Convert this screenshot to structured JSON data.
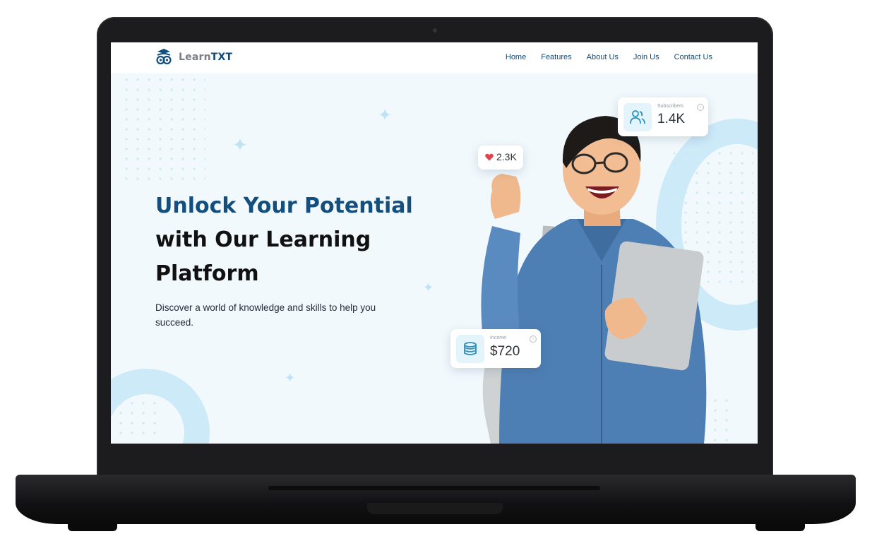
{
  "brand": {
    "name_part1": "Learn",
    "name_part2": "TXT"
  },
  "nav": [
    "Home",
    "Features",
    "About Us",
    "Join Us",
    "Contact Us"
  ],
  "hero": {
    "headline_highlight": "Unlock Your Potential",
    "headline_rest": "with Our Learning Platform",
    "subtitle": "Discover a world of knowledge and skills to help you succeed."
  },
  "stats": {
    "likes": "2.3K",
    "subscribers_label": "Subscribers",
    "subscribers_value": "1.4K",
    "income_label": "Income",
    "income_value": "$720"
  },
  "icons": [
    "owl-logo-icon",
    "heart-icon",
    "users-icon",
    "coins-icon",
    "info-icon",
    "sparkle-icon"
  ],
  "colors": {
    "primary": "#124f7e",
    "accent": "#cdeaf9",
    "heart": "#e0454e",
    "background": "#f2f9fd"
  }
}
